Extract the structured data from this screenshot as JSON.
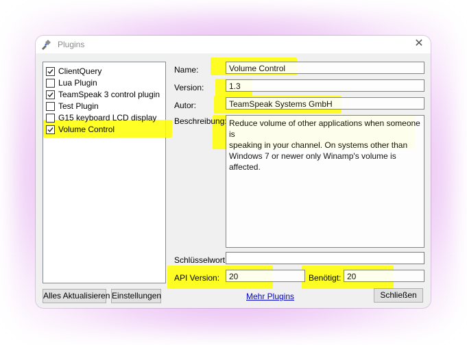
{
  "window": {
    "title": "Plugins",
    "close_glyph": "✕"
  },
  "plugins": [
    {
      "name": "ClientQuery",
      "checked": true,
      "highlight": false
    },
    {
      "name": "Lua Plugin",
      "checked": false,
      "highlight": false
    },
    {
      "name": "TeamSpeak 3 control plugin",
      "checked": true,
      "highlight": false
    },
    {
      "name": "Test Plugin",
      "checked": false,
      "highlight": false
    },
    {
      "name": "G15 keyboard LCD display",
      "checked": false,
      "highlight": false
    },
    {
      "name": "Volume Control",
      "checked": true,
      "highlight": true
    }
  ],
  "details": {
    "name_label": "Name:",
    "name_value": "Volume Control",
    "version_label": "Version:",
    "version_value": "1.3",
    "author_label": "Autor:",
    "author_value": "TeamSpeak Systems GmbH",
    "description_label": "Beschreibung:",
    "description_lines": [
      "Reduce volume of other applications when someone is",
      "speaking in your channel. On systems other than",
      "Windows 7 or newer only Winamp's volume is affected."
    ],
    "keyword_label": "Schlüsselwort:",
    "keyword_value": "",
    "api_label": "API Version:",
    "api_value": "20",
    "required_label": "Benötigt:",
    "required_value": "20"
  },
  "buttons": {
    "refresh_all": "Alles Aktualisieren",
    "settings": "Einstellungen",
    "more_plugins": "Mehr Plugins",
    "close": "Schließen"
  },
  "colors": {
    "highlight": "#ffff00",
    "link": "#0000cc",
    "glow": "#c85adc"
  }
}
